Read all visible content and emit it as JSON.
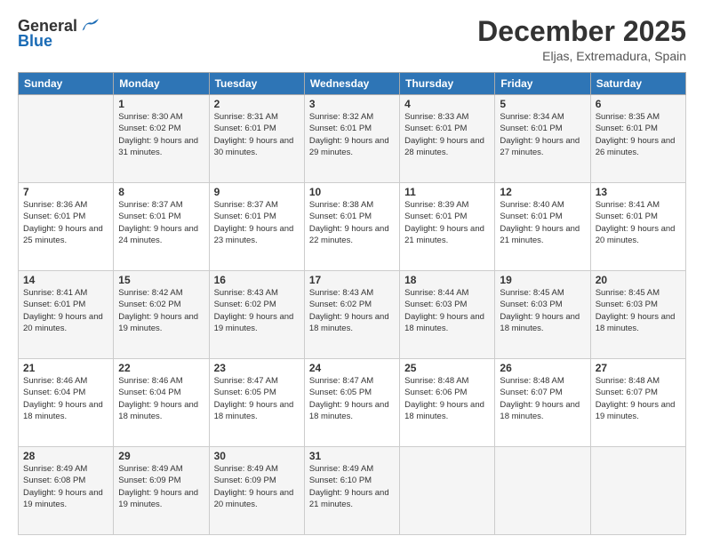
{
  "header": {
    "logo_general": "General",
    "logo_blue": "Blue",
    "month_title": "December 2025",
    "location": "Eljas, Extremadura, Spain"
  },
  "weekdays": [
    "Sunday",
    "Monday",
    "Tuesday",
    "Wednesday",
    "Thursday",
    "Friday",
    "Saturday"
  ],
  "weeks": [
    [
      {
        "day": "",
        "sunrise": "",
        "sunset": "",
        "daylight": ""
      },
      {
        "day": "1",
        "sunrise": "Sunrise: 8:30 AM",
        "sunset": "Sunset: 6:02 PM",
        "daylight": "Daylight: 9 hours and 31 minutes."
      },
      {
        "day": "2",
        "sunrise": "Sunrise: 8:31 AM",
        "sunset": "Sunset: 6:01 PM",
        "daylight": "Daylight: 9 hours and 30 minutes."
      },
      {
        "day": "3",
        "sunrise": "Sunrise: 8:32 AM",
        "sunset": "Sunset: 6:01 PM",
        "daylight": "Daylight: 9 hours and 29 minutes."
      },
      {
        "day": "4",
        "sunrise": "Sunrise: 8:33 AM",
        "sunset": "Sunset: 6:01 PM",
        "daylight": "Daylight: 9 hours and 28 minutes."
      },
      {
        "day": "5",
        "sunrise": "Sunrise: 8:34 AM",
        "sunset": "Sunset: 6:01 PM",
        "daylight": "Daylight: 9 hours and 27 minutes."
      },
      {
        "day": "6",
        "sunrise": "Sunrise: 8:35 AM",
        "sunset": "Sunset: 6:01 PM",
        "daylight": "Daylight: 9 hours and 26 minutes."
      }
    ],
    [
      {
        "day": "7",
        "sunrise": "Sunrise: 8:36 AM",
        "sunset": "Sunset: 6:01 PM",
        "daylight": "Daylight: 9 hours and 25 minutes."
      },
      {
        "day": "8",
        "sunrise": "Sunrise: 8:37 AM",
        "sunset": "Sunset: 6:01 PM",
        "daylight": "Daylight: 9 hours and 24 minutes."
      },
      {
        "day": "9",
        "sunrise": "Sunrise: 8:37 AM",
        "sunset": "Sunset: 6:01 PM",
        "daylight": "Daylight: 9 hours and 23 minutes."
      },
      {
        "day": "10",
        "sunrise": "Sunrise: 8:38 AM",
        "sunset": "Sunset: 6:01 PM",
        "daylight": "Daylight: 9 hours and 22 minutes."
      },
      {
        "day": "11",
        "sunrise": "Sunrise: 8:39 AM",
        "sunset": "Sunset: 6:01 PM",
        "daylight": "Daylight: 9 hours and 21 minutes."
      },
      {
        "day": "12",
        "sunrise": "Sunrise: 8:40 AM",
        "sunset": "Sunset: 6:01 PM",
        "daylight": "Daylight: 9 hours and 21 minutes."
      },
      {
        "day": "13",
        "sunrise": "Sunrise: 8:41 AM",
        "sunset": "Sunset: 6:01 PM",
        "daylight": "Daylight: 9 hours and 20 minutes."
      }
    ],
    [
      {
        "day": "14",
        "sunrise": "Sunrise: 8:41 AM",
        "sunset": "Sunset: 6:01 PM",
        "daylight": "Daylight: 9 hours and 20 minutes."
      },
      {
        "day": "15",
        "sunrise": "Sunrise: 8:42 AM",
        "sunset": "Sunset: 6:02 PM",
        "daylight": "Daylight: 9 hours and 19 minutes."
      },
      {
        "day": "16",
        "sunrise": "Sunrise: 8:43 AM",
        "sunset": "Sunset: 6:02 PM",
        "daylight": "Daylight: 9 hours and 19 minutes."
      },
      {
        "day": "17",
        "sunrise": "Sunrise: 8:43 AM",
        "sunset": "Sunset: 6:02 PM",
        "daylight": "Daylight: 9 hours and 18 minutes."
      },
      {
        "day": "18",
        "sunrise": "Sunrise: 8:44 AM",
        "sunset": "Sunset: 6:03 PM",
        "daylight": "Daylight: 9 hours and 18 minutes."
      },
      {
        "day": "19",
        "sunrise": "Sunrise: 8:45 AM",
        "sunset": "Sunset: 6:03 PM",
        "daylight": "Daylight: 9 hours and 18 minutes."
      },
      {
        "day": "20",
        "sunrise": "Sunrise: 8:45 AM",
        "sunset": "Sunset: 6:03 PM",
        "daylight": "Daylight: 9 hours and 18 minutes."
      }
    ],
    [
      {
        "day": "21",
        "sunrise": "Sunrise: 8:46 AM",
        "sunset": "Sunset: 6:04 PM",
        "daylight": "Daylight: 9 hours and 18 minutes."
      },
      {
        "day": "22",
        "sunrise": "Sunrise: 8:46 AM",
        "sunset": "Sunset: 6:04 PM",
        "daylight": "Daylight: 9 hours and 18 minutes."
      },
      {
        "day": "23",
        "sunrise": "Sunrise: 8:47 AM",
        "sunset": "Sunset: 6:05 PM",
        "daylight": "Daylight: 9 hours and 18 minutes."
      },
      {
        "day": "24",
        "sunrise": "Sunrise: 8:47 AM",
        "sunset": "Sunset: 6:05 PM",
        "daylight": "Daylight: 9 hours and 18 minutes."
      },
      {
        "day": "25",
        "sunrise": "Sunrise: 8:48 AM",
        "sunset": "Sunset: 6:06 PM",
        "daylight": "Daylight: 9 hours and 18 minutes."
      },
      {
        "day": "26",
        "sunrise": "Sunrise: 8:48 AM",
        "sunset": "Sunset: 6:07 PM",
        "daylight": "Daylight: 9 hours and 18 minutes."
      },
      {
        "day": "27",
        "sunrise": "Sunrise: 8:48 AM",
        "sunset": "Sunset: 6:07 PM",
        "daylight": "Daylight: 9 hours and 19 minutes."
      }
    ],
    [
      {
        "day": "28",
        "sunrise": "Sunrise: 8:49 AM",
        "sunset": "Sunset: 6:08 PM",
        "daylight": "Daylight: 9 hours and 19 minutes."
      },
      {
        "day": "29",
        "sunrise": "Sunrise: 8:49 AM",
        "sunset": "Sunset: 6:09 PM",
        "daylight": "Daylight: 9 hours and 19 minutes."
      },
      {
        "day": "30",
        "sunrise": "Sunrise: 8:49 AM",
        "sunset": "Sunset: 6:09 PM",
        "daylight": "Daylight: 9 hours and 20 minutes."
      },
      {
        "day": "31",
        "sunrise": "Sunrise: 8:49 AM",
        "sunset": "Sunset: 6:10 PM",
        "daylight": "Daylight: 9 hours and 21 minutes."
      },
      {
        "day": "",
        "sunrise": "",
        "sunset": "",
        "daylight": ""
      },
      {
        "day": "",
        "sunrise": "",
        "sunset": "",
        "daylight": ""
      },
      {
        "day": "",
        "sunrise": "",
        "sunset": "",
        "daylight": ""
      }
    ]
  ]
}
